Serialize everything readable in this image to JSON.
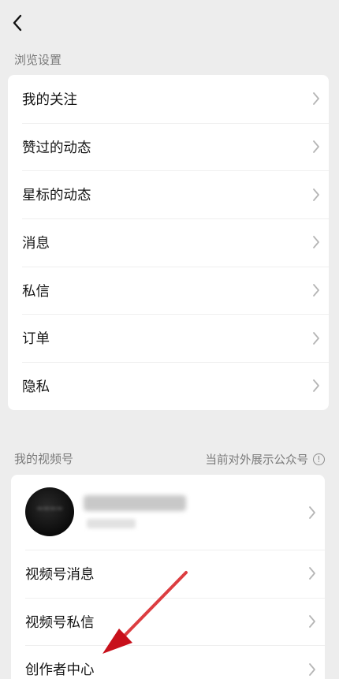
{
  "browse": {
    "section_title": "浏览设置",
    "items": [
      {
        "label": "我的关注"
      },
      {
        "label": "赞过的动态"
      },
      {
        "label": "星标的动态"
      },
      {
        "label": "消息"
      },
      {
        "label": "私信"
      },
      {
        "label": "订单"
      },
      {
        "label": "隐私"
      }
    ]
  },
  "channels": {
    "section_title": "我的视频号",
    "current_account_note": "当前对外展示公众号",
    "items": [
      {
        "label": "视频号消息"
      },
      {
        "label": "视频号私信"
      },
      {
        "label": "创作者中心"
      }
    ]
  },
  "icons": {
    "back": "chevron-left-icon",
    "row_arrow": "chevron-right-icon",
    "info": "info-circle-icon"
  },
  "colors": {
    "background": "#ededed",
    "card": "#ffffff",
    "annotation_arrow": "#d3202a"
  }
}
